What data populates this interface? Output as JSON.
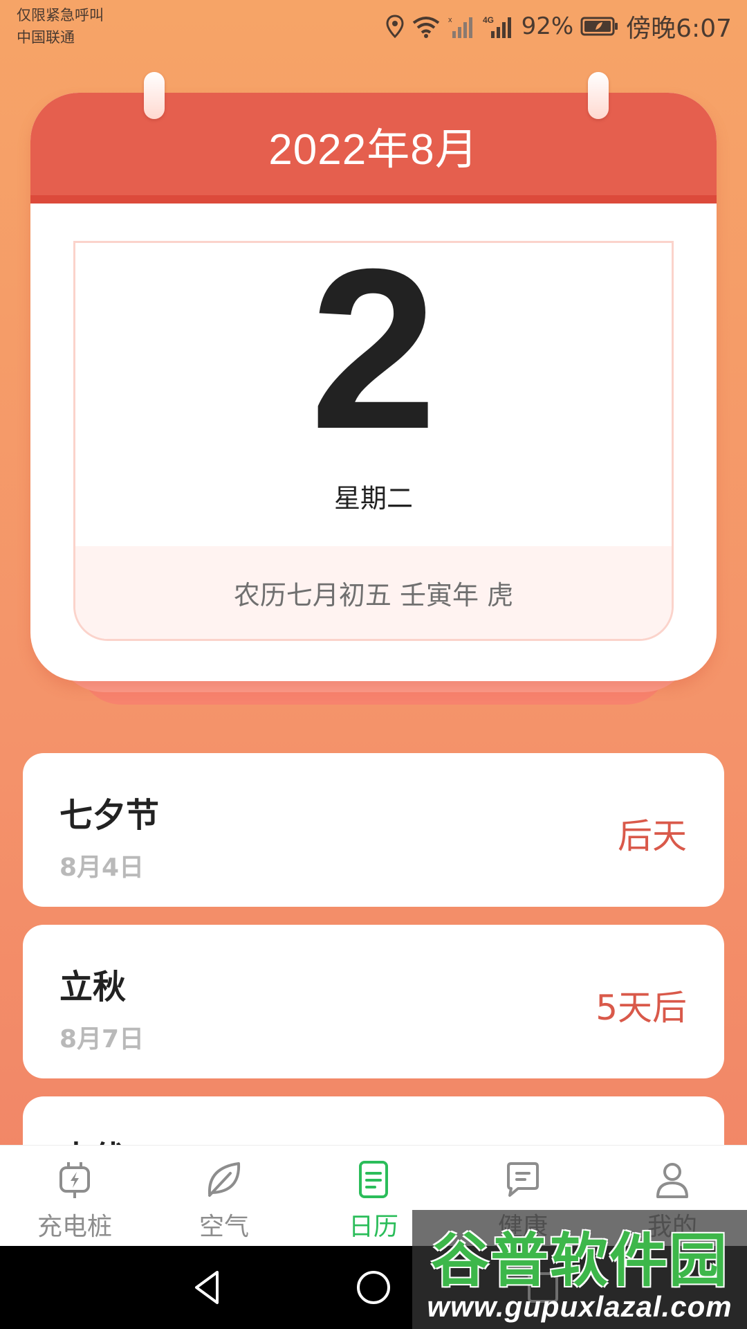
{
  "status_bar": {
    "carrier_line1": "仅限紧急呼叫",
    "carrier_line2": "中国联通",
    "network_label": "4G",
    "battery_percent": "92%",
    "time": "傍晚6:07",
    "icons": [
      "location-icon",
      "wifi-icon",
      "signal-icon",
      "battery-icon"
    ]
  },
  "calendar": {
    "month": "2022年8月",
    "day": "2",
    "weekday": "星期二",
    "lunar": "农历七月初五 壬寅年 虎"
  },
  "events": [
    {
      "name": "七夕节",
      "date": "8月4日",
      "relative": "后天"
    },
    {
      "name": "立秋",
      "date": "8月7日",
      "relative": "5天后"
    },
    {
      "name": "末伏",
      "date": "",
      "relative": ""
    }
  ],
  "bottom_nav": {
    "active_index": 2,
    "items": [
      {
        "label": "充电桩",
        "icon": "charging-pile-icon"
      },
      {
        "label": "空气",
        "icon": "leaf-icon"
      },
      {
        "label": "日历",
        "icon": "calendar-icon"
      },
      {
        "label": "健康",
        "icon": "health-icon"
      },
      {
        "label": "我的",
        "icon": "profile-icon"
      }
    ]
  },
  "watermark": {
    "title": "谷普软件园",
    "url": "www.gupuxlazal.com"
  },
  "colors": {
    "background_top": "#f6a467",
    "background_bottom": "#f18266",
    "calendar_header": "#e55f4e",
    "event_relative": "#d9594a",
    "nav_active": "#2bbd5a",
    "nav_inactive": "#8d8d8d"
  }
}
